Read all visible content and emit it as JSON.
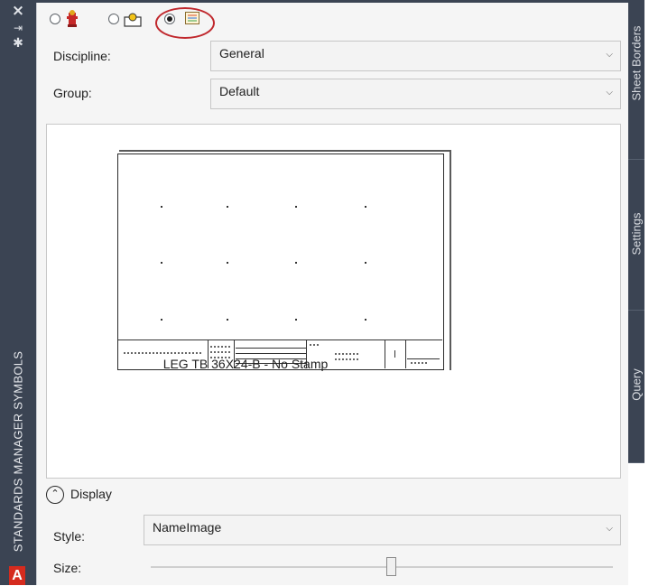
{
  "palette": {
    "title": "STANDARDS MANAGER SYMBOLS",
    "close_icon": "×",
    "pin_icon": "⇥",
    "settings_icon": "✱",
    "logo": "A"
  },
  "toolbar": {
    "options": [
      {
        "icon": "fire-hydrant-icon",
        "selected": false
      },
      {
        "icon": "manhole-icon",
        "selected": false
      },
      {
        "icon": "sheet-border-icon",
        "selected": true
      }
    ]
  },
  "fields": {
    "discipline": {
      "label": "Discipline:",
      "value": "General"
    },
    "group": {
      "label": "Group:",
      "value": "Default"
    }
  },
  "preview": {
    "items": [
      {
        "name": "LEG TB 36X24-B - No Stamp"
      }
    ]
  },
  "display": {
    "section_label": "Display",
    "style_label": "Style:",
    "style_value": "NameImage",
    "size_label": "Size:",
    "size_level": 0.52
  },
  "side_tabs": [
    "Sheet Borders",
    "Settings",
    "Query"
  ],
  "colors": {
    "palette_bar": "#3b4453",
    "highlight_ring": "#c0282d",
    "logo": "#d52b1e"
  }
}
